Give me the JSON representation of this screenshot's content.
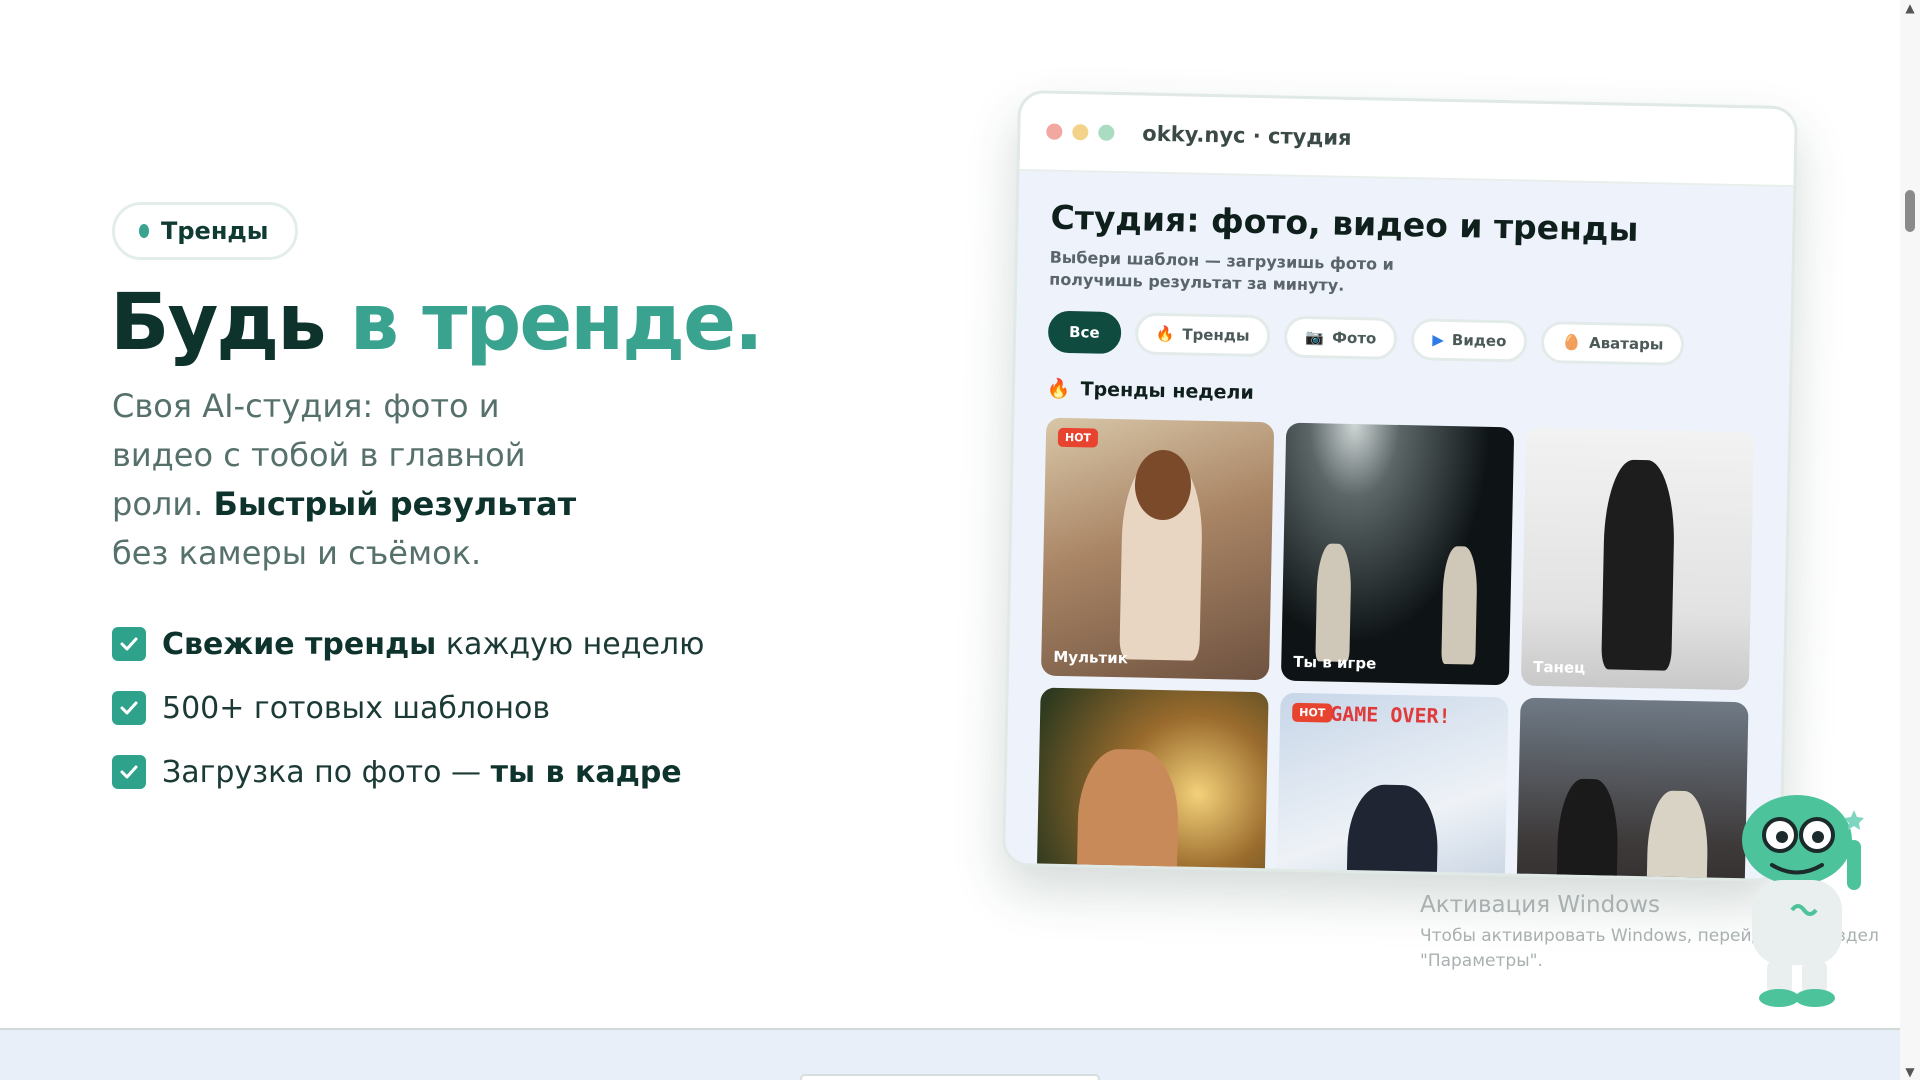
{
  "hero": {
    "badge_label": "Тренды",
    "title_main": "Будь ",
    "title_accent": "в тренде.",
    "subtitle_plain": "Своя AI-студия: фото и видео с тобой в главной роли. ",
    "subtitle_bold": "Быстрый результат",
    "subtitle_tail": " без камеры и съёмок.",
    "features": [
      {
        "bold": "Свежие тренды",
        "text": " каждую неделю"
      },
      {
        "bold": "",
        "text": "500+ готовых шаблонов"
      },
      {
        "bold": "ты в кадре",
        "text": "Загрузка по фото — "
      }
    ]
  },
  "mockup": {
    "url": "okky.nyc · студия",
    "title": "Студия: фото, видео и тренды",
    "subtitle": "Выбери шаблон — загрузишь фото и получишь результат за минуту.",
    "chips": [
      {
        "label": "Все",
        "icon": "",
        "active": true
      },
      {
        "label": "Тренды",
        "icon": "🔥"
      },
      {
        "label": "Фото",
        "icon": "📷"
      },
      {
        "label": "Видео",
        "icon": "▶"
      },
      {
        "label": "Аватары",
        "icon": "🥚"
      }
    ],
    "section_title": "Тренды недели",
    "section_icon": "🔥",
    "tiles": [
      {
        "label": "Мультик",
        "hot": "HOT"
      },
      {
        "label": "Ты в игре",
        "hot": ""
      },
      {
        "label": "Танец",
        "hot": ""
      },
      {
        "label": "",
        "hot": ""
      },
      {
        "label": "",
        "hot": "HOT",
        "overlay": "GAME OVER!"
      },
      {
        "label": "",
        "hot": ""
      }
    ]
  },
  "watermark": {
    "title": "Активация Windows",
    "line1": "Чтобы активировать Windows, перейдите в раздел",
    "line2": "\"Параметры\"."
  },
  "colors": {
    "accent": "#3aa38f",
    "dark": "#0d332c",
    "check": "#2fa28c",
    "chip_active": "#0f4b3f"
  }
}
